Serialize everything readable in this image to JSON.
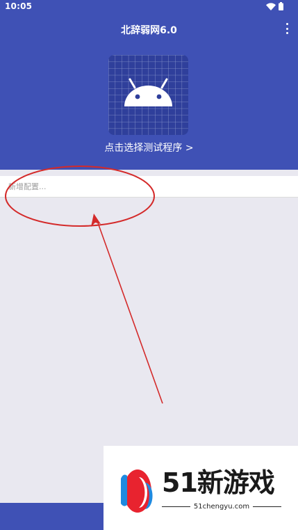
{
  "status_bar": {
    "time": "10:05"
  },
  "app_bar": {
    "title": "北辞弱网6.0",
    "menu_icon": "more-vert-icon"
  },
  "program_selector": {
    "icon": "android-icon",
    "label": "点击选择测试程序 >"
  },
  "config_input": {
    "placeholder": "新增配置..."
  },
  "annotation": {
    "color": "#d42a2a"
  },
  "watermark": {
    "brand": "51新游戏",
    "url": "51chengyu.com"
  },
  "colors": {
    "primary": "#3f51b5",
    "background": "#e9e8f0",
    "android_green": "#ffffff"
  }
}
